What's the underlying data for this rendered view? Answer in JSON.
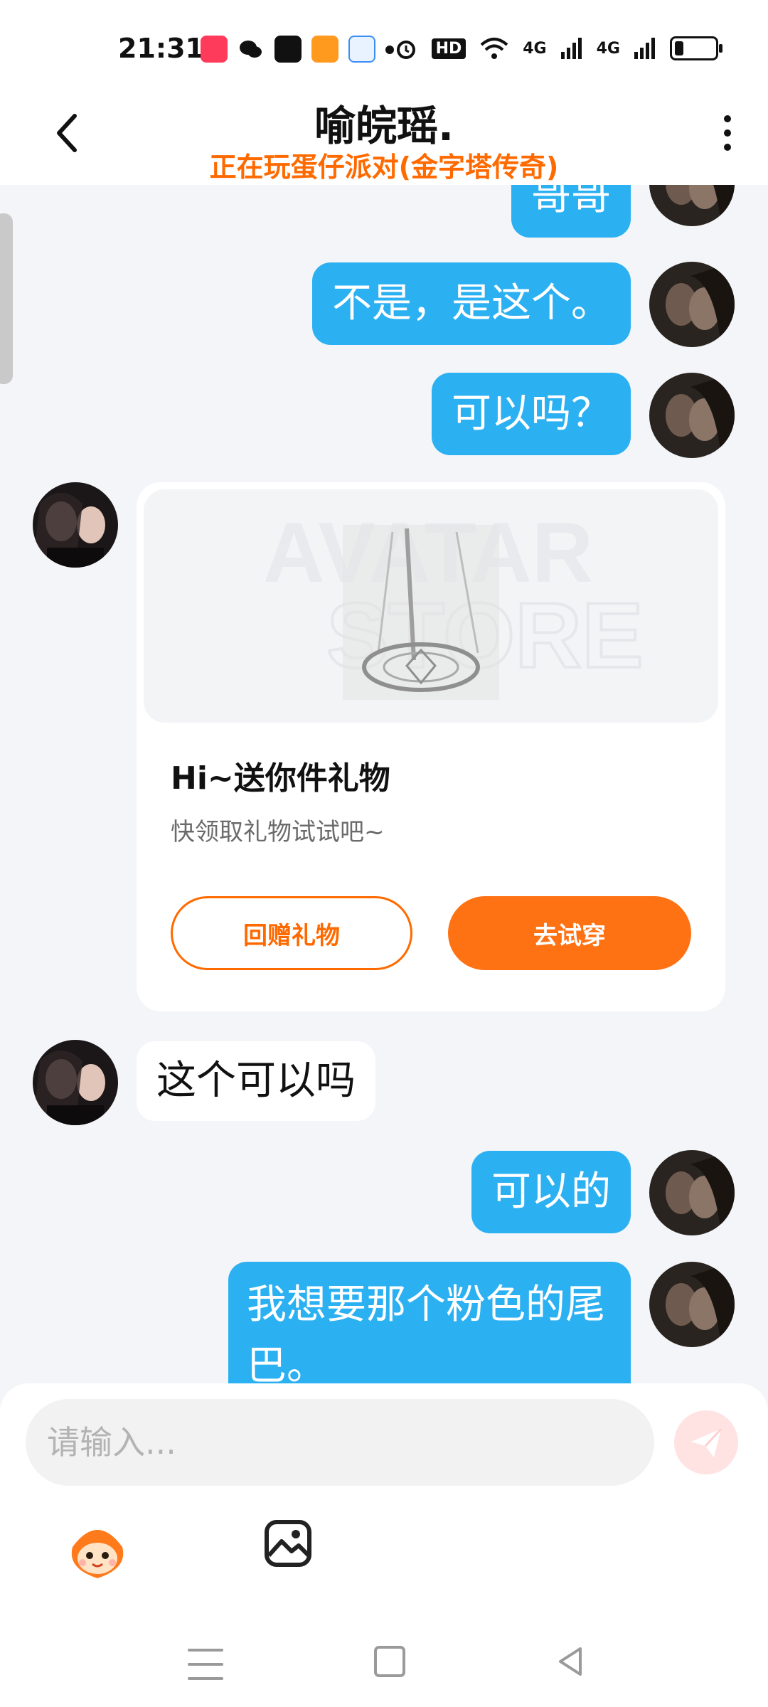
{
  "status_bar": {
    "time": "21:31",
    "hd_label": "HD",
    "network_1": "4G",
    "network_2": "4G"
  },
  "header": {
    "title": "喻皖瑶.",
    "subtitle": "正在玩蛋仔派对(金字塔传奇)",
    "back_icon": "chevron-left-icon",
    "more_icon": "more-vertical-icon"
  },
  "messages": [
    {
      "side": "me",
      "text": "哥哥"
    },
    {
      "side": "me",
      "text": "不是，是这个。"
    },
    {
      "side": "me",
      "text": "可以吗？"
    },
    {
      "side": "other",
      "type": "gift_card"
    },
    {
      "side": "other",
      "text": "这个可以吗"
    },
    {
      "side": "me",
      "text": "可以的"
    },
    {
      "side": "me",
      "text": "我想要那个粉色的尾巴。"
    }
  ],
  "gift_card": {
    "title": "Hi~送你件礼物",
    "description": "快领取礼物试试吧~",
    "return_button": "回赠礼物",
    "try_button": "去试穿",
    "watermark_line1": "AVATAR",
    "watermark_line2": "STORE"
  },
  "composer": {
    "placeholder": "请输入..."
  },
  "colors": {
    "bubble_me": "#2bb0f2",
    "accent_orange": "#ff6a00",
    "background": "#f3f5f8"
  }
}
